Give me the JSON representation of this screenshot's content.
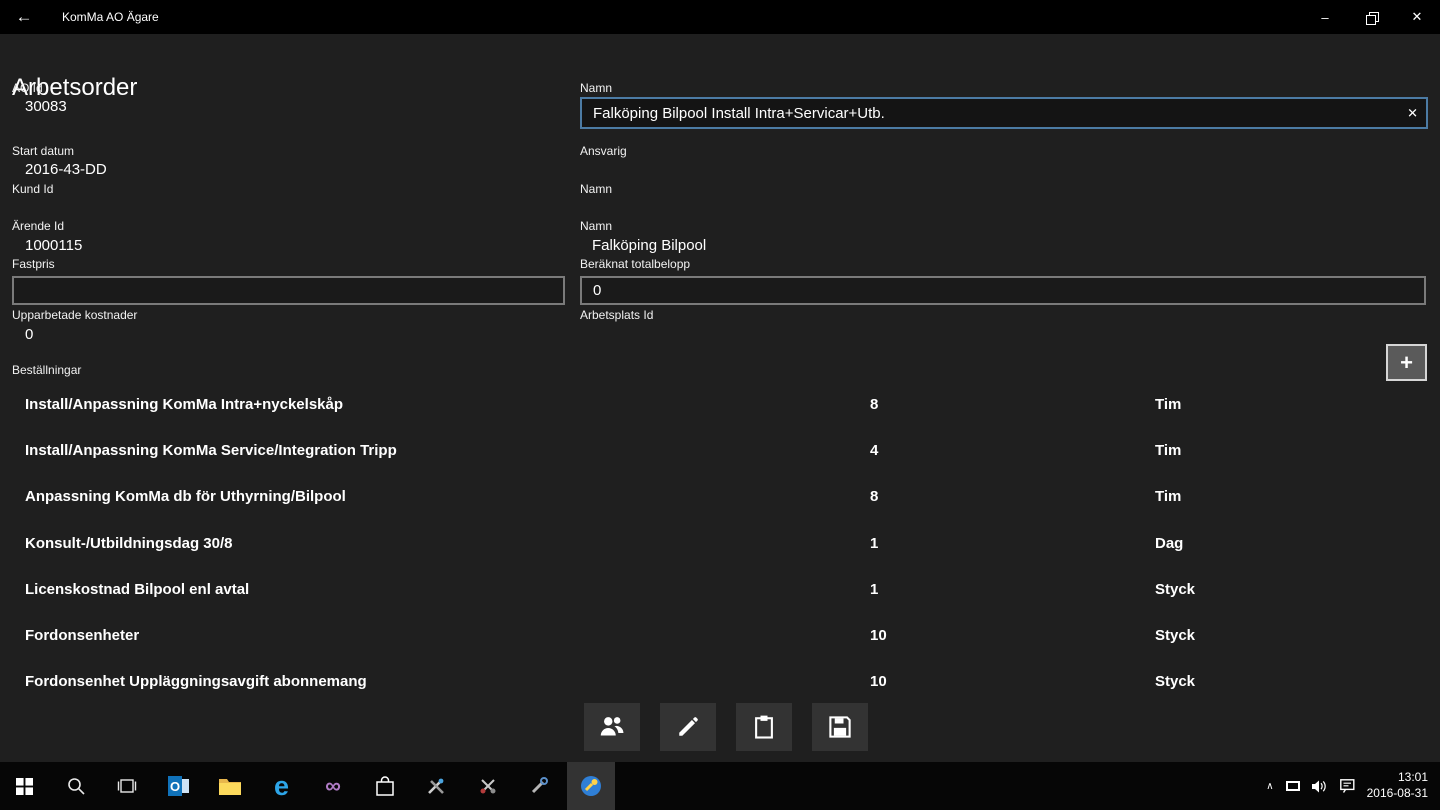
{
  "titlebar": {
    "title": "KomMa AO Ägare",
    "back_glyph": "←"
  },
  "window": {
    "minimize_glyph": "–",
    "close_glyph": "✕"
  },
  "heading": "Arbetsorder",
  "fields": {
    "ao_id": {
      "label": "AO Id",
      "value": "30083"
    },
    "namn": {
      "label": "Namn",
      "value": "Falköping Bilpool Install Intra+Servicar+Utb.",
      "clear_glyph": "✕"
    },
    "start_datum": {
      "label": "Start datum",
      "value": "2016-43-DD"
    },
    "ansvarig": {
      "label": "Ansvarig",
      "value": ""
    },
    "kund_id": {
      "label": "Kund Id",
      "value": ""
    },
    "namn2": {
      "label": "Namn",
      "value": ""
    },
    "arende_id": {
      "label": "Ärende Id",
      "value": "1000115"
    },
    "namn3": {
      "label": "Namn",
      "value": "Falköping Bilpool"
    },
    "fastpris": {
      "label": "Fastpris",
      "value": ""
    },
    "beraknat": {
      "label": "Beräknat totalbelopp",
      "value": "0"
    },
    "upparbetade": {
      "label": "Upparbetade kostnader",
      "value": "0"
    },
    "arbetsplats": {
      "label": "Arbetsplats Id",
      "value": ""
    }
  },
  "orders": {
    "label": "Beställningar",
    "add_label": "+",
    "rows": [
      {
        "name": "Install/Anpassning KomMa Intra+nyckelskåp",
        "qty": "8",
        "unit": "Tim"
      },
      {
        "name": "Install/Anpassning KomMa Service/Integration Tripp",
        "qty": "4",
        "unit": "Tim"
      },
      {
        "name": "Anpassning KomMa db för Uthyrning/Bilpool",
        "qty": "8",
        "unit": "Tim"
      },
      {
        "name": "Konsult-/Utbildningsdag 30/8",
        "qty": "1",
        "unit": "Dag"
      },
      {
        "name": "Licenskostnad Bilpool enl avtal",
        "qty": "1",
        "unit": "Styck"
      },
      {
        "name": "Fordonsenheter",
        "qty": "10",
        "unit": "Styck"
      },
      {
        "name": "Fordonsenhet Uppläggningsavgift abonnemang",
        "qty": "10",
        "unit": "Styck"
      }
    ]
  },
  "action_buttons": [
    {
      "name": "people"
    },
    {
      "name": "edit"
    },
    {
      "name": "clipboard"
    },
    {
      "name": "save"
    }
  ],
  "taskbar": {
    "icons": [
      "start",
      "search",
      "task-view",
      "outlook",
      "file-explorer",
      "edge",
      "visual-studio",
      "store",
      "tools",
      "scissors",
      "wrench",
      "komma-active"
    ],
    "tray_icons": [
      "chevron-up",
      "network-display",
      "volume",
      "action-center"
    ],
    "glyphs": {
      "edge": "e",
      "vs": "∞",
      "outlook": "O",
      "chevron": "∧"
    },
    "time": "13:01",
    "date": "2016-08-31"
  },
  "colors": {
    "titlebar_bg": "#000000",
    "content_bg": "#1f1f1f",
    "taskbar_bg": "#060606",
    "focused_input_border": "#4c7ba4",
    "folder_yellow": "#fcd95c",
    "edge_blue": "#2da5e8",
    "vs_purple": "#b07cc6",
    "outlook_blue": "#1072ba"
  }
}
